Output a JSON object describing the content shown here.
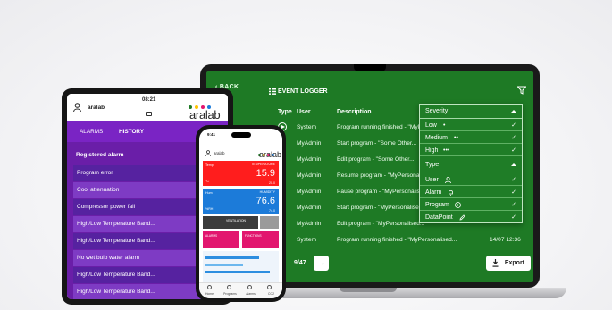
{
  "laptop": {
    "back_label": "BACK",
    "title": "EVENT LOGGER",
    "columns": {
      "type": "Type",
      "user": "User",
      "description": "Description"
    },
    "rows": [
      {
        "user": "System",
        "description": "Program running finished - \"MyPersonalised...",
        "date": ""
      },
      {
        "user": "MyAdmin",
        "description": "Start program - \"Some Other...",
        "date": ""
      },
      {
        "user": "MyAdmin",
        "description": "Edit program - \"Some Other...",
        "date": ""
      },
      {
        "user": "MyAdmin",
        "description": "Resume program - \"MyPersonalised...",
        "date": ""
      },
      {
        "user": "MyAdmin",
        "description": "Pause program - \"MyPersonalised...",
        "date": ""
      },
      {
        "user": "MyAdmin",
        "description": "Start program - \"MyPersonalised...",
        "date": ""
      },
      {
        "user": "MyAdmin",
        "description": "Edit program - \"MyPersonalised...",
        "date": ""
      },
      {
        "user": "System",
        "description": "Program running finished - \"MyPersonalised...",
        "date": "14/07 12:36"
      }
    ],
    "pager": "9/47",
    "export_label": "Export",
    "filter": {
      "severity_label": "Severity",
      "severity": [
        {
          "label": "Low",
          "glyph": "•"
        },
        {
          "label": "Medium",
          "glyph": "••"
        },
        {
          "label": "High",
          "glyph": "•••"
        }
      ],
      "type_label": "Type",
      "types": [
        {
          "label": "User"
        },
        {
          "label": "Alarm"
        },
        {
          "label": "Program"
        },
        {
          "label": "DataPoint"
        }
      ],
      "check": "✓"
    }
  },
  "tablet": {
    "time": "08:21",
    "brand": "aralab",
    "logo": "aralab",
    "tabs": [
      "ALARMS",
      "HISTORY"
    ],
    "section_title": "Registered alarm",
    "alarms": [
      "Program error",
      "Cool attenuation",
      "Compressor power fail",
      "High/Low Temperature Band...",
      "High/Low Temperature Band...",
      "No wet bulb water alarm",
      "High/Low Temperature Band...",
      "High/Low Temperature Band..."
    ]
  },
  "phone": {
    "time": "9:41",
    "brand": "aralab",
    "logo": "aralab",
    "temp_caption": "TEMPERATURE",
    "temp_value": "15.9",
    "temp_set": "20.0",
    "temp_unit": "°C",
    "hum_caption": "HUMIDITY",
    "hum_value": "76.6",
    "hum_set": "74.0",
    "hum_unit": "%RH",
    "hum_label": "Hum",
    "temp_label": "Temp",
    "ventilation": "VENTILATION",
    "alarms_label": "ALARMS",
    "functions_label": "FUNCTIONS",
    "nav": [
      "Home",
      "Programs",
      "Alarms",
      "CO2"
    ]
  },
  "colors": {
    "laptop_bg": "#1e7a25",
    "tablet_purple": "#7a24c4",
    "phone_red": "#ff1d1d",
    "phone_blue": "#1c7bd9",
    "phone_pink": "#e2166e"
  }
}
